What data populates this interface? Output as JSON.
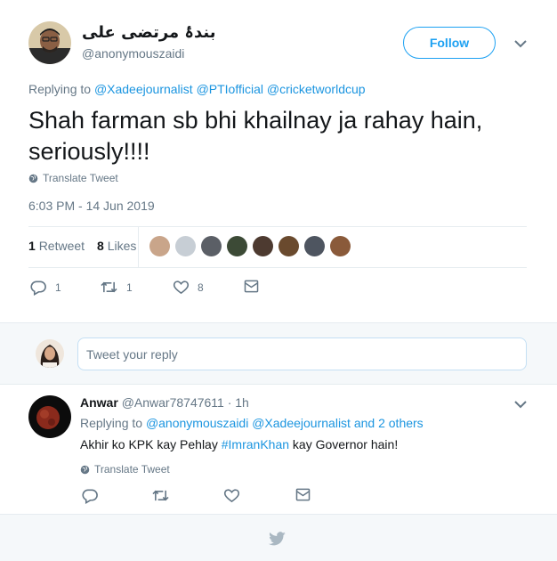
{
  "tweet": {
    "display_name": "بندۂ مرتضی علی",
    "handle": "@anonymouszaidi",
    "follow_label": "Follow",
    "replying_prefix": "Replying to",
    "replying_to": [
      "@Xadeejournalist",
      "@PTIofficial",
      "@cricketworldcup"
    ],
    "text_line1": "Shah farman sb bhi khailnay ja rahay hain,",
    "text_line2": "seriously!!!!",
    "translate_label": "Translate Tweet",
    "timestamp": "6:03 PM - 14 Jun 2019",
    "retweet_count": "1",
    "retweet_label": "Retweet",
    "like_count": "8",
    "like_label": "Likes",
    "liker_colors": [
      "#c9a58a",
      "#c7ced5",
      "#5b5f66",
      "#3c4a36",
      "#4d3a30",
      "#6a4a2e",
      "#4e5560",
      "#8a5a3a"
    ],
    "actions": {
      "replies": "1",
      "retweets": "1",
      "likes": "8"
    }
  },
  "reply_box": {
    "placeholder": "Tweet your reply"
  },
  "reply": {
    "name": "Anwar",
    "handle_time": "@Anwar78747611 · 1h",
    "replying_prefix": "Replying to",
    "replying_to": [
      "@anonymouszaidi",
      "@Xadeejournalist"
    ],
    "replying_suffix": "and 2 others",
    "text_before": "Akhir ko KPK kay Pehlay",
    "hashtag": "#ImranKhan",
    "text_after": "kay Governor hain!",
    "translate_label": "Translate Tweet"
  },
  "colors": {
    "accent": "#1da1f2",
    "link": "#1b95e0",
    "muted": "#657786",
    "background_alt": "#f5f8fa"
  },
  "icons": [
    "globe-icon",
    "chevron-down-icon",
    "reply-icon",
    "retweet-icon",
    "heart-icon",
    "message-icon",
    "twitter-bird-icon"
  ]
}
